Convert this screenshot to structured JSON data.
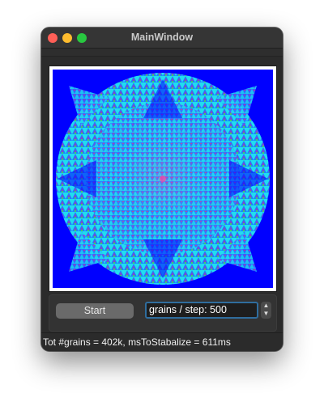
{
  "window": {
    "title": "MainWindow"
  },
  "canvas": {
    "description_colors": [
      "#0000ff",
      "#00ffff",
      "#40c060",
      "#c040c0",
      "#ff2020"
    ]
  },
  "controls": {
    "start_label": "Start",
    "grains_per_step": "grains / step: 500"
  },
  "status": {
    "text": "Tot #grains = 402k, msToStabalize = 611ms"
  }
}
